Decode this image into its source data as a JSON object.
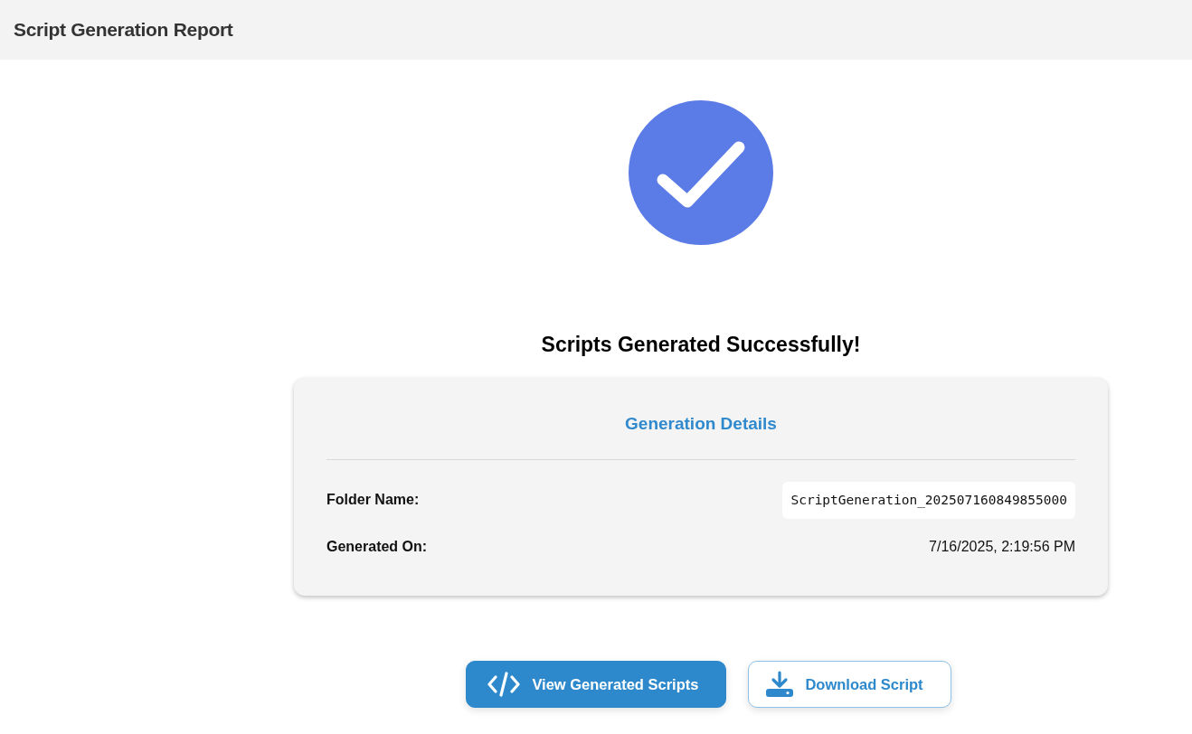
{
  "header": {
    "title": "Script Generation Report"
  },
  "status": {
    "kind": "success",
    "message": "Scripts Generated Successfully!"
  },
  "details": {
    "title": "Generation Details",
    "rows": [
      {
        "label": "Folder Name:",
        "value": "ScriptGeneration_202507160849855000",
        "kind": "code"
      },
      {
        "label": "Generated On:",
        "value": "7/16/2025, 2:19:56 PM",
        "kind": "text"
      }
    ]
  },
  "buttons": [
    {
      "label": "View Generated Scripts",
      "kind": "primary"
    },
    {
      "label": "Download Script",
      "kind": "outline"
    }
  ]
}
